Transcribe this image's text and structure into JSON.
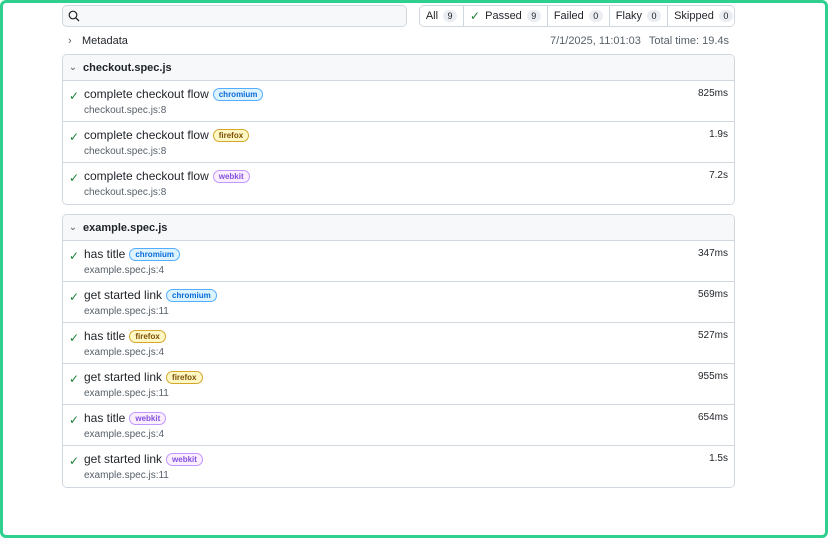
{
  "search": {
    "placeholder": ""
  },
  "filters": [
    {
      "label": "All",
      "count": "9"
    },
    {
      "label": "Passed",
      "count": "9"
    },
    {
      "label": "Failed",
      "count": "0"
    },
    {
      "label": "Flaky",
      "count": "0"
    },
    {
      "label": "Skipped",
      "count": "0"
    }
  ],
  "metadata": {
    "label": "Metadata",
    "date": "7/1/2025, 11:01:03",
    "total_time": "Total time: 19.4s"
  },
  "groups": [
    {
      "file": "checkout.spec.js",
      "tests": [
        {
          "title": "complete checkout flow",
          "project": "chromium",
          "location": "checkout.spec.js:8",
          "duration": "825ms"
        },
        {
          "title": "complete checkout flow",
          "project": "firefox",
          "location": "checkout.spec.js:8",
          "duration": "1.9s"
        },
        {
          "title": "complete checkout flow",
          "project": "webkit",
          "location": "checkout.spec.js:8",
          "duration": "7.2s"
        }
      ]
    },
    {
      "file": "example.spec.js",
      "tests": [
        {
          "title": "has title",
          "project": "chromium",
          "location": "example.spec.js:4",
          "duration": "347ms"
        },
        {
          "title": "get started link",
          "project": "chromium",
          "location": "example.spec.js:11",
          "duration": "569ms"
        },
        {
          "title": "has title",
          "project": "firefox",
          "location": "example.spec.js:4",
          "duration": "527ms"
        },
        {
          "title": "get started link",
          "project": "firefox",
          "location": "example.spec.js:11",
          "duration": "955ms"
        },
        {
          "title": "has title",
          "project": "webkit",
          "location": "example.spec.js:4",
          "duration": "654ms"
        },
        {
          "title": "get started link",
          "project": "webkit",
          "location": "example.spec.js:11",
          "duration": "1.5s"
        }
      ]
    }
  ],
  "icons": {
    "search": "search-icon",
    "passed": "check-icon",
    "collapse": "chevron-down-icon",
    "expand": "chevron-right-icon"
  },
  "colors": {
    "frame": "#2ecf8f",
    "passed": "#1a7f37",
    "chromium": "#0969da",
    "firefox": "#7d4e00",
    "webkit": "#8250df"
  }
}
